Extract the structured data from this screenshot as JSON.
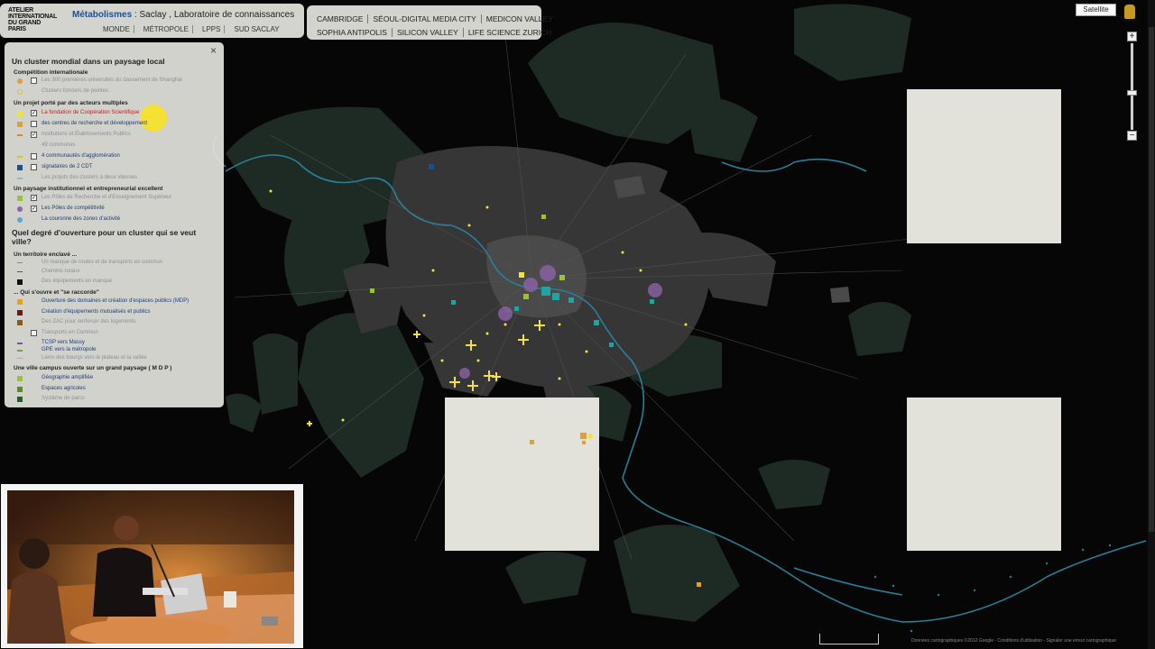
{
  "header": {
    "logo_lines": [
      "ATELIER",
      "INTERNATIONAL",
      "DU GRAND",
      "PARIS"
    ],
    "title_accent": "Métabolismes",
    "title_rest": " : Saclay , Laboratoire de connaissances",
    "nav": [
      "MONDE",
      "MÉTROPOLE",
      "LPPS",
      "SUD SACLAY"
    ]
  },
  "clusters": {
    "row1": [
      "CAMBRIDGE",
      "SÉOUL-DIGITAL MEDIA CITY",
      "MEDICON VALLEY"
    ],
    "row2": [
      "SOPHIA ANTIPOLIS",
      "SILICON VALLEY",
      "LIFE SCIENCE ZURICH"
    ]
  },
  "legend": {
    "close": "×",
    "section1_title": "Un cluster mondial dans un paysage local",
    "competition_title": "Compétition internationale",
    "competition_items": [
      {
        "text": "Les 300 premières universités du classement de Shanghai",
        "check": "",
        "faded": true
      },
      {
        "text": "Clusters fonciers de pointes",
        "check": "",
        "faded": true
      }
    ],
    "projet_title": "Un projet porté par des acteurs multiples",
    "projet_items": [
      {
        "text": "La fondation de Coopération Scientifique",
        "check": "✓",
        "faded": false,
        "red": true
      },
      {
        "text": "des centres de recherche et développement",
        "check": "",
        "faded": false
      },
      {
        "text": "Institutions et Établissements Publics",
        "check": "✓",
        "faded": true
      },
      {
        "text": "49 communes",
        "check": "",
        "faded": true
      },
      {
        "text": "4 communautés d'agglomération",
        "check": "",
        "faded": false
      },
      {
        "text": "signataires de 2 CDT",
        "check": "",
        "faded": false
      },
      {
        "text": "Les projets des clusters à deux vitesses",
        "check": "",
        "faded": true
      }
    ],
    "paysage_title": "Un paysage institutionnel et entrepreneurial excellent",
    "paysage_items": [
      {
        "text": "Les Pôles de Recherche et d'Enseignement Supérieur",
        "check": "✓",
        "faded": true
      },
      {
        "text": "Les Pôles de compétitivité",
        "check": "✓",
        "faded": false
      },
      {
        "text": "La couronne des zones d'activité",
        "check": "",
        "faded": false
      }
    ],
    "section2_title": "Quel degré d'ouverture pour un cluster qui se veut ville?",
    "enclave_title": "Un territoire enclavé ...",
    "enclave_items": [
      {
        "text": "Un manque de routes et de transports en commun",
        "faded": true
      },
      {
        "text": "Chemins ruraux",
        "faded": true
      },
      {
        "text": "Des équipements en manque",
        "faded": true
      }
    ],
    "ouvert_title": "... Qui s'ouvre et \"se raccorde\"",
    "ouvert_items": [
      {
        "text": "Ouverture des domaines et création d'espaces publics (MDP)",
        "faded": false
      },
      {
        "text": "Création d'équipements mutualisés et publics",
        "faded": false
      },
      {
        "text": "Des ZAC pour renforcer des logements",
        "faded": true
      },
      {
        "text": "Transports en Commun",
        "faded": true
      },
      {
        "text": "TCSP vers Massy",
        "faded": false
      },
      {
        "text": "GPE vers la métropole",
        "faded": false
      },
      {
        "text": "Liens des bourgs vers le plateau et la vallée",
        "faded": true
      }
    ],
    "campus_title": "Une ville campus ouverte sur un grand paysage ( M D P )",
    "campus_items": [
      {
        "text": "Géographie amplifiée",
        "faded": false
      },
      {
        "text": "Espaces agricoles",
        "faded": false
      },
      {
        "text": "Système de parcs",
        "faded": true
      }
    ]
  },
  "controls": {
    "map_type": "Satellite",
    "zoom_in": "+",
    "zoom_out": "−"
  },
  "attribution": "Données cartographiques ©2012 Google - Conditions d'utilisation - Signaler une erreur cartographique",
  "colors": {
    "accent_blue": "#1d4f93",
    "legend_text": "#1d3d78",
    "legend_red": "#d01818",
    "map_background": "#060606",
    "urban_grey": "#3a3a3a",
    "green_space": "#1d2b24",
    "river": "#2a7f9a",
    "marker_yellow": "#f4e23c",
    "marker_purple": "#8b63a8",
    "marker_teal": "#22a2a0"
  }
}
